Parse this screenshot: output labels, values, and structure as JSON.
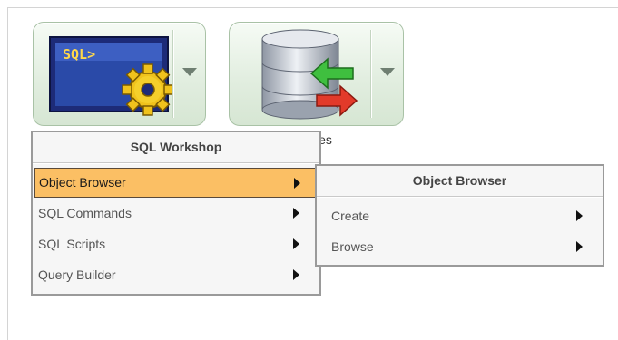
{
  "tiles": {
    "sql_workshop": {
      "icon_text": "SQL>",
      "icon": "sql-console-gear-icon"
    },
    "utilities": {
      "icon": "database-import-export-icon",
      "label_fragment": "ies"
    }
  },
  "menu": {
    "title": "SQL Workshop",
    "items": [
      {
        "label": "Object Browser",
        "active": true
      },
      {
        "label": "SQL Commands"
      },
      {
        "label": "SQL Scripts"
      },
      {
        "label": "Query Builder"
      }
    ]
  },
  "submenu": {
    "title": "Object Browser",
    "items": [
      {
        "label": "Create"
      },
      {
        "label": "Browse"
      }
    ]
  },
  "colors": {
    "active_item": "#fbbf64",
    "menu_border": "#9a9a9a",
    "tile_border": "#a9c2a6"
  }
}
